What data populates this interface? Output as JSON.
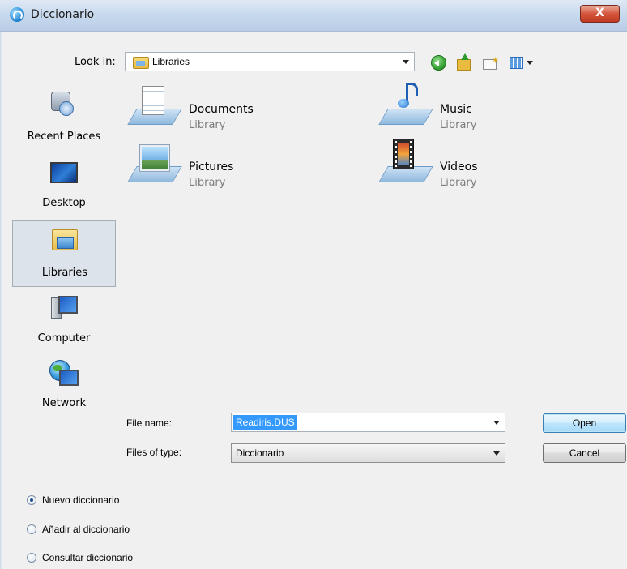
{
  "window": {
    "title": "Diccionario",
    "close_glyph": "X"
  },
  "lookin": {
    "label": "Look in:",
    "value": "Libraries",
    "icon": "libraries-icon"
  },
  "toolbar": {
    "back_icon": "back-icon",
    "up_icon": "up-folder-icon",
    "new_folder_icon": "new-folder-icon",
    "views_icon": "views-menu-icon"
  },
  "places": [
    {
      "label": "Recent Places",
      "icon": "recent-places-icon"
    },
    {
      "label": "Desktop",
      "icon": "desktop-icon"
    },
    {
      "label": "Libraries",
      "icon": "libraries-icon",
      "selected": true
    },
    {
      "label": "Computer",
      "icon": "computer-icon"
    },
    {
      "label": "Network",
      "icon": "network-icon"
    }
  ],
  "items": [
    {
      "name": "Documents",
      "type": "Library",
      "icon": "documents-library-icon"
    },
    {
      "name": "Music",
      "type": "Library",
      "icon": "music-library-icon"
    },
    {
      "name": "Pictures",
      "type": "Library",
      "icon": "pictures-library-icon"
    },
    {
      "name": "Videos",
      "type": "Library",
      "icon": "videos-library-icon"
    }
  ],
  "filename": {
    "label": "File name:",
    "value": "Readiris.DUS"
  },
  "filetype": {
    "label": "Files of type:",
    "value": "Diccionario"
  },
  "buttons": {
    "open": "Open",
    "cancel": "Cancel"
  },
  "options": [
    {
      "label": "Nuevo diccionario",
      "checked": true
    },
    {
      "label": "Añadir al diccionario",
      "checked": false
    },
    {
      "label": "Consultar diccionario",
      "checked": false
    }
  ],
  "colors": {
    "title_gradient_top": "#dfe9f5",
    "close_red": "#c03a22",
    "selection_blue": "#3399ff",
    "library_subtext": "#7c7c7c"
  }
}
